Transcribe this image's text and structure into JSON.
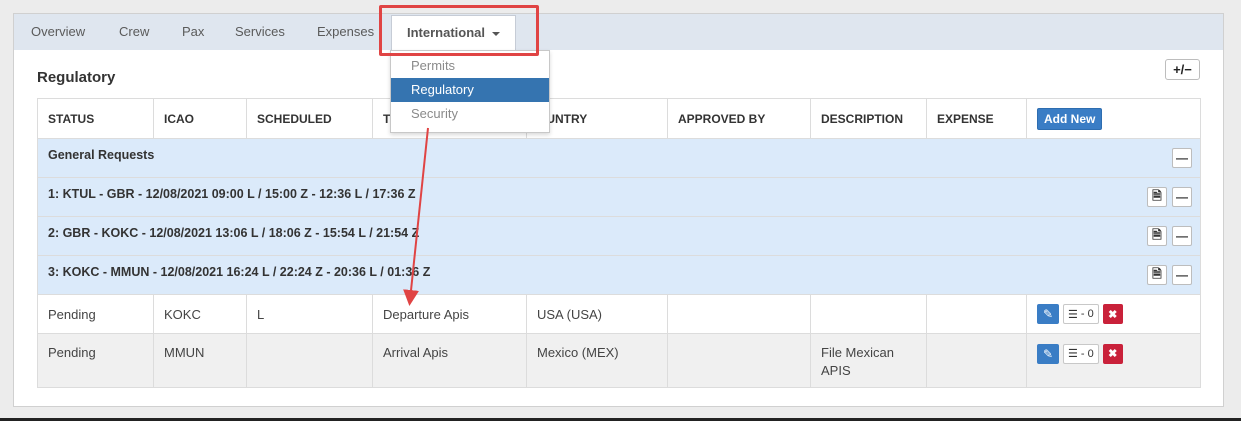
{
  "tabs": [
    {
      "label": "Overview"
    },
    {
      "label": "Crew"
    },
    {
      "label": "Pax"
    },
    {
      "label": "Services"
    },
    {
      "label": "Expenses"
    },
    {
      "label": "International"
    }
  ],
  "dropdown": {
    "items": [
      {
        "label": "Permits"
      },
      {
        "label": "Regulatory"
      },
      {
        "label": "Security"
      }
    ],
    "selected": "Regulatory"
  },
  "section": {
    "title": "Regulatory",
    "toggle_label": "+/−"
  },
  "table": {
    "headers": {
      "status": "STATUS",
      "icao": "ICAO",
      "scheduled": "SCHEDULED",
      "type": "T",
      "country": "OUNTRY",
      "approved_by": "APPROVED BY",
      "description": "DESCRIPTION",
      "expense": "EXPENSE"
    },
    "add_new_label": "Add New",
    "groups": [
      {
        "label": "General Requests"
      },
      {
        "label": "1: KTUL - GBR - 12/08/2021 09:00 L / 15:00 Z - 12:36 L / 17:36 Z"
      },
      {
        "label": "2: GBR - KOKC - 12/08/2021 13:06 L / 18:06 Z - 15:54 L / 21:54 Z"
      },
      {
        "label": "3: KOKC - MMUN - 12/08/2021 16:24 L / 22:24 Z - 20:36 L / 01:36 Z"
      }
    ],
    "rows": [
      {
        "status": "Pending",
        "icao": "KOKC",
        "scheduled": "L",
        "type": "Departure Apis",
        "country": "USA (USA)",
        "approved_by": "",
        "description": "",
        "expense": "",
        "count": "- 0"
      },
      {
        "status": "Pending",
        "icao": "MMUN",
        "scheduled": "",
        "type": "Arrival Apis",
        "country": "Mexico (MEX)",
        "approved_by": "",
        "description": "File Mexican APIS",
        "expense": "",
        "count": "- 0"
      }
    ]
  },
  "colors": {
    "tab_bar": "#dfe6ef",
    "group_row": "#dbeafa",
    "primary_button": "#3a7dc5",
    "delete_button": "#c9213a",
    "highlight": "#e04444"
  }
}
